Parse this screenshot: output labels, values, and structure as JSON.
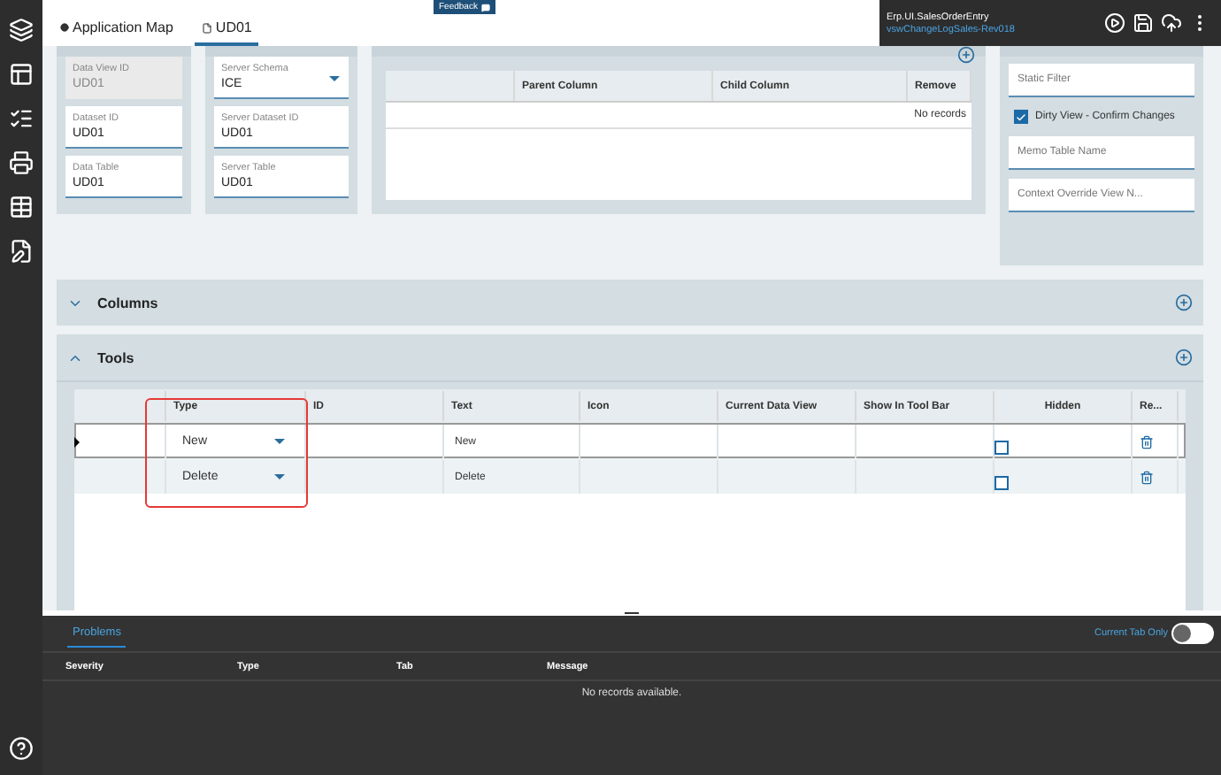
{
  "tabs": [
    {
      "label": "Application Map",
      "selected": false,
      "kind": "map"
    },
    {
      "label": "UD01",
      "selected": true,
      "kind": "doc"
    }
  ],
  "feedback": "Feedback",
  "context": {
    "title": "Erp.UI.SalesOrderEntry",
    "link": "vswChangeLogSales-Rev018"
  },
  "data_view": {
    "fields": [
      {
        "label": "Data View ID",
        "value": "UD01",
        "disabled": true
      },
      {
        "label": "Dataset ID",
        "value": "UD01",
        "disabled": false
      },
      {
        "label": "Data Table",
        "value": "UD01",
        "disabled": false
      }
    ]
  },
  "server_view": {
    "fields": [
      {
        "label": "Server Schema",
        "value": "ICE",
        "kind": "dropdown"
      },
      {
        "label": "Server Dataset ID",
        "value": "UD01",
        "kind": "text"
      },
      {
        "label": "Server Table",
        "value": "UD01",
        "kind": "text"
      }
    ]
  },
  "relationships": {
    "columns": [
      "",
      "Parent Column",
      "Child Column",
      "Remove"
    ],
    "empty": "No records"
  },
  "options": {
    "items": [
      {
        "kind": "field",
        "placeholder": "Static Filter"
      },
      {
        "kind": "checkbox",
        "label": "Dirty View - Confirm Changes",
        "checked": true
      },
      {
        "kind": "field",
        "placeholder": "Memo Table Name"
      },
      {
        "kind": "field",
        "placeholder": "Context Override View N..."
      }
    ]
  },
  "sections": [
    {
      "title": "Columns",
      "expanded": false
    },
    {
      "title": "Tools",
      "expanded": true
    }
  ],
  "tools": {
    "columns": [
      "",
      "Type",
      "ID",
      "Text",
      "Icon",
      "Current Data View",
      "Show In Tool Bar",
      "Hidden",
      "Re..."
    ],
    "rows": [
      {
        "type": "New",
        "text": "New",
        "hidden": false,
        "selected": true
      },
      {
        "type": "Delete",
        "text": "Delete",
        "hidden": false,
        "selected": false
      }
    ]
  },
  "problems": {
    "tabs": [
      {
        "label": "Problems",
        "selected": true
      }
    ],
    "toggle": {
      "label": "Current Tab Only",
      "on": false
    },
    "columns": [
      "Severity",
      "Type",
      "Tab",
      "Message"
    ],
    "empty": "No records available."
  }
}
